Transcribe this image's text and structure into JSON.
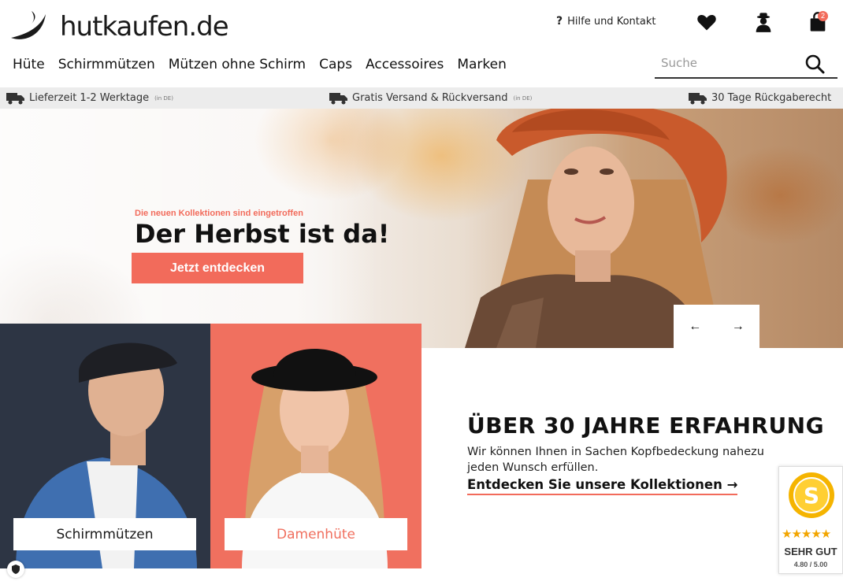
{
  "brand": {
    "logo_text": "hutkaufen.de"
  },
  "header": {
    "help_label": "Hilfe und Kontakt",
    "cart_count": "2"
  },
  "nav": [
    "Hüte",
    "Schirmmützen",
    "Mützen ohne Schirm",
    "Caps",
    "Accessoires",
    "Marken"
  ],
  "search": {
    "placeholder": "Suche"
  },
  "usp": [
    {
      "text": "Lieferzeit 1-2 Werktage",
      "note": "(in DE)"
    },
    {
      "text": "Gratis Versand & Rückversand",
      "note": "(in DE)"
    },
    {
      "text": "30 Tage Rückgaberecht",
      "note": ""
    }
  ],
  "hero": {
    "kicker": "Die neuen Kollektionen sind eingetroffen",
    "title": "Der Herbst ist da!",
    "cta": "Jetzt entdecken",
    "prev": "←",
    "next": "→"
  },
  "tiles": {
    "men": "Schirmmützen",
    "women": "Damenhüte"
  },
  "about": {
    "title": "ÜBER 30 JAHRE ERFAHRUNG",
    "text": "Wir können Ihnen in Sachen Kopfbedeckung nahezu jeden Wunsch erfüllen.",
    "link": "Entdecken Sie unsere Kollektionen  →"
  },
  "trust_badge": {
    "seal_letter": "S",
    "stars": "★★★★★",
    "label": "SEHR GUT",
    "value": "4.80 / 5.00"
  },
  "colors": {
    "accent": "#f26b5b",
    "dark_tile": "#2d3544",
    "coral_tile": "#f0705f"
  }
}
